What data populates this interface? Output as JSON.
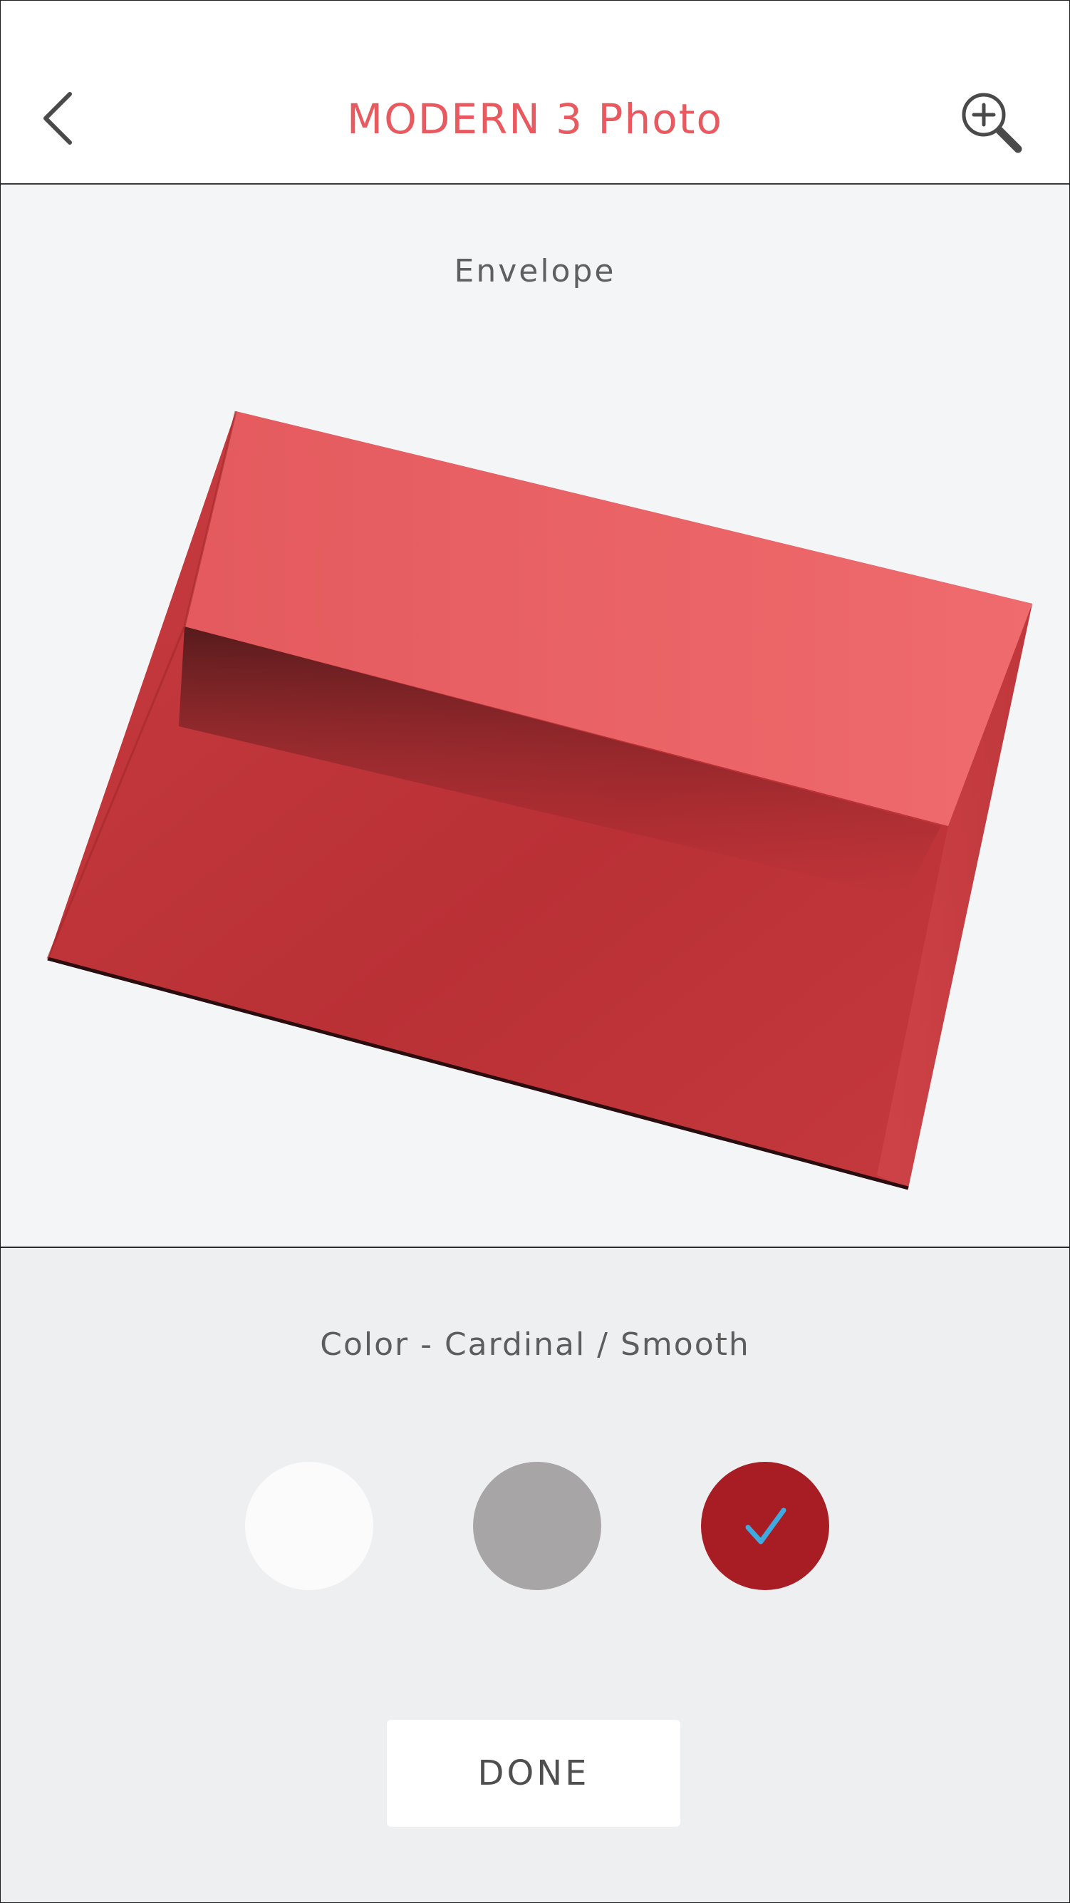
{
  "header": {
    "title": "MODERN 3 Photo",
    "back_icon": "chevron-left-icon",
    "zoom_icon": "zoom-in-icon",
    "title_color": "#e85a5f"
  },
  "preview": {
    "label": "Envelope",
    "image": "red-envelope-image",
    "envelope_color": "#c93a3f"
  },
  "options": {
    "color_label": "Color - Cardinal / Smooth",
    "swatches": [
      {
        "name": "white",
        "color": "#fbfbfb",
        "selected": false
      },
      {
        "name": "gray",
        "color": "#a7a5a6",
        "selected": false
      },
      {
        "name": "cardinal",
        "color": "#a81c23",
        "selected": true
      }
    ],
    "check_icon": "checkmark-icon",
    "check_color": "#3fa9e0"
  },
  "footer": {
    "done_label": "DONE"
  }
}
